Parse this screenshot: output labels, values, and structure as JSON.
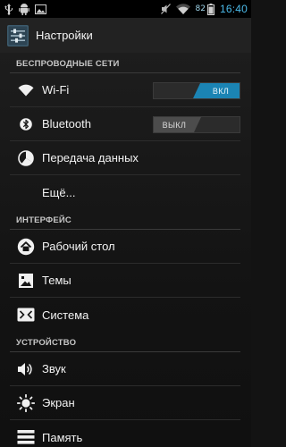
{
  "status_bar": {
    "battery_percent": "82",
    "time": "16:40",
    "left_icons": [
      "usb-icon",
      "android-debug-icon",
      "image-icon"
    ],
    "right_icons": [
      "mute-icon",
      "wifi-signal-icon",
      "battery-icon"
    ]
  },
  "action_bar": {
    "title": "Настройки",
    "icon": "settings-sliders-icon"
  },
  "sections": {
    "wireless": {
      "header": "БЕСПРОВОДНЫЕ СЕТИ",
      "wifi": {
        "label": "Wi-Fi",
        "toggle": "ВКЛ",
        "state": "on"
      },
      "bluetooth": {
        "label": "Bluetooth",
        "toggle": "ВЫКЛ",
        "state": "off"
      },
      "data_usage": {
        "label": "Передача данных"
      },
      "more": {
        "label": "Ещё..."
      }
    },
    "interface": {
      "header": "ИНТЕРФЕЙС",
      "desktop": {
        "label": "Рабочий стол"
      },
      "themes": {
        "label": "Темы"
      },
      "system": {
        "label": "Система"
      }
    },
    "device": {
      "header": "УСТРОЙСТВО",
      "sound": {
        "label": "Звук"
      },
      "display": {
        "label": "Экран"
      },
      "memory": {
        "label": "Память"
      }
    }
  },
  "colors": {
    "accent": "#1b84b4",
    "clock": "#4bb9e8",
    "background": "#131313"
  }
}
